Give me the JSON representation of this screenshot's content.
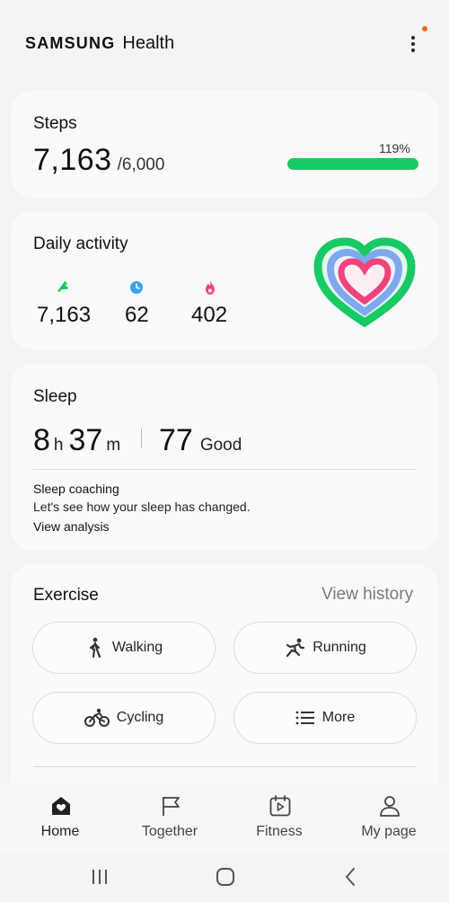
{
  "header": {
    "brand_samsung": "SAMSUNG",
    "brand_health": "Health"
  },
  "steps": {
    "title": "Steps",
    "count": "7,163",
    "goal": "/6,000",
    "percent_label": "119%",
    "progress": 1.0
  },
  "daily_activity": {
    "title": "Daily activity",
    "items": [
      {
        "icon": "steps-shoe-icon",
        "value": "7,163",
        "color": "#19c964"
      },
      {
        "icon": "clock-icon",
        "value": "62",
        "color": "#3aa3f2"
      },
      {
        "icon": "flame-icon",
        "value": "402",
        "color": "#f0437c"
      }
    ]
  },
  "sleep": {
    "title": "Sleep",
    "hours": "8",
    "hours_unit": "h",
    "minutes": "37",
    "minutes_unit": "m",
    "score": "77",
    "score_label": "Good",
    "coaching_title": "Sleep coaching",
    "coaching_text": "Let's see how your sleep has changed.",
    "coaching_link": "View analysis"
  },
  "exercise": {
    "title": "Exercise",
    "view_history": "View history",
    "buttons": [
      {
        "label": "Walking",
        "icon": "walking-icon"
      },
      {
        "label": "Running",
        "icon": "running-icon"
      },
      {
        "label": "Cycling",
        "icon": "cycling-icon"
      },
      {
        "label": "More",
        "icon": "list-icon"
      }
    ]
  },
  "bottom_nav": [
    {
      "label": "Home",
      "icon": "home-icon",
      "active": true
    },
    {
      "label": "Together",
      "icon": "flag-icon",
      "active": false
    },
    {
      "label": "Fitness",
      "icon": "fitness-calendar-icon",
      "active": false
    },
    {
      "label": "My page",
      "icon": "person-icon",
      "active": false
    }
  ],
  "colors": {
    "accent_green": "#19c964",
    "accent_blue": "#3aa3f2",
    "accent_pink": "#f0437c",
    "notification_dot": "#f06a1c"
  }
}
